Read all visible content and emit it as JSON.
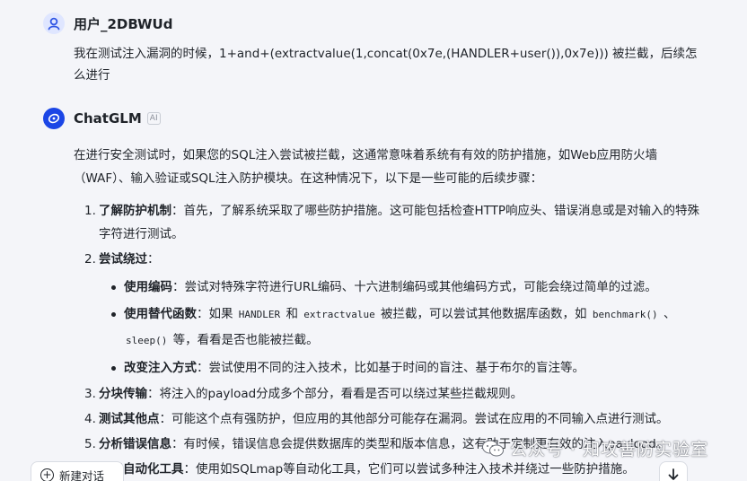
{
  "user": {
    "name": "用户_2DBWUd",
    "message": "我在测试注入漏洞的时候，1+and+(extractvalue(1,concat(0x7e,(HANDLER+user()),0x7e))) 被拦截，后续怎么进行"
  },
  "bot": {
    "name": "ChatGLM",
    "badge": "AI",
    "intro": "在进行安全测试时，如果您的SQL注入尝试被拦截，这通常意味着系统有有效的防护措施，如Web应用防火墙（WAF）、输入验证或SQL注入防护模块。在这种情况下，以下是一些可能的后续步骤：",
    "steps": [
      {
        "num": "1.",
        "title": "了解防护机制",
        "text": "：首先，了解系统采取了哪些防护措施。这可能包括检查HTTP响应头、错误消息或是对输入的特殊字符进行测试。"
      },
      {
        "num": "2.",
        "title": "尝试绕过",
        "text": "："
      },
      {
        "num": "3.",
        "title": "分块传输",
        "text": "：将注入的payload分成多个部分，看看是否可以绕过某些拦截规则。"
      },
      {
        "num": "4.",
        "title": "测试其他点",
        "text": "：可能这个点有强防护，但应用的其他部分可能存在漏洞。尝试在应用的不同输入点进行测试。"
      },
      {
        "num": "5.",
        "title": "分析错误信息",
        "text": "：有时候，错误信息会提供数据库的类型和版本信息，这有助于定制更有效的注入payload。"
      },
      {
        "num": "6.",
        "title": "使用自动化工具",
        "text": "：使用如SQLmap等自动化工具，它们可以尝试多种注入技术并绕过一些防护措施。"
      }
    ],
    "bypass": [
      {
        "title": "使用编码",
        "text": "：尝试对特殊字符进行URL编码、十六进制编码或其他编码方式，可能会绕过简单的过滤。"
      },
      {
        "title": "使用替代函数",
        "t1": "：如果 ",
        "c1": "HANDLER",
        "t2": " 和 ",
        "c2": "extractvalue",
        "t3": " 被拦截，可以尝试其他数据库函数，如 ",
        "c3": "benchmark()",
        "t4": " 、",
        "c4": "sleep()",
        "t5": " 等，看看是否也能被拦截。"
      },
      {
        "title": "改变注入方式",
        "text": "：尝试使用不同的注入技术，比如基于时间的盲注、基于布尔的盲注等。"
      }
    ]
  },
  "footer": {
    "new_chat": "新建对话",
    "scroll_icon": "arrow-down-icon",
    "watermark": "公众号 · 知攻善防实验室"
  },
  "colors": {
    "bot_avatar": "#1b46e6",
    "user_avatar": "#dfe6ff",
    "background": "#f4f5f9"
  }
}
